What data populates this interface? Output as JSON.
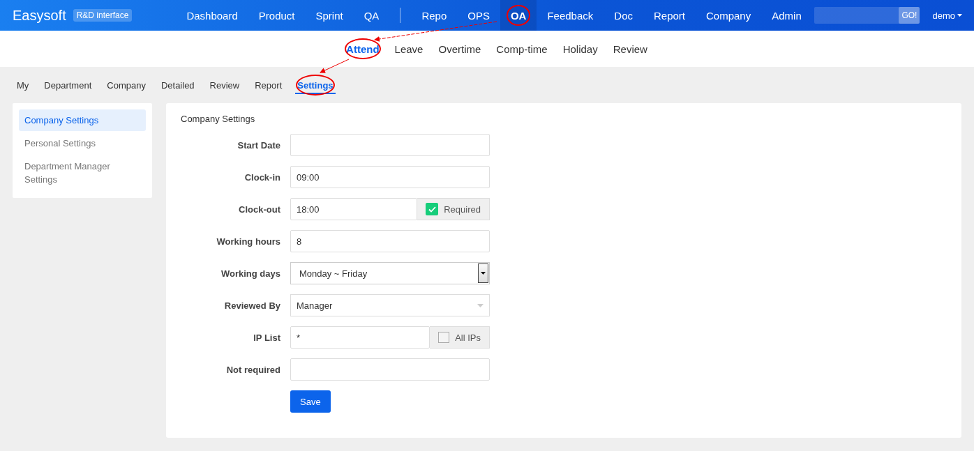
{
  "brand": {
    "name": "Easysoft",
    "badge": "R&D interface"
  },
  "main_nav": [
    {
      "label": "Dashboard",
      "selected": false,
      "annotated": false,
      "divider_after": false
    },
    {
      "label": "Product",
      "selected": false,
      "annotated": false,
      "divider_after": false
    },
    {
      "label": "Sprint",
      "selected": false,
      "annotated": false,
      "divider_after": false
    },
    {
      "label": "QA",
      "selected": false,
      "annotated": false,
      "divider_after": true
    },
    {
      "label": "Repo",
      "selected": false,
      "annotated": false,
      "divider_after": false
    },
    {
      "label": "OPS",
      "selected": false,
      "annotated": false,
      "divider_after": false
    },
    {
      "label": "OA",
      "selected": true,
      "annotated": true,
      "divider_after": false
    },
    {
      "label": "Feedback",
      "selected": false,
      "annotated": false,
      "divider_after": false
    },
    {
      "label": "Doc",
      "selected": false,
      "annotated": false,
      "divider_after": false
    },
    {
      "label": "Report",
      "selected": false,
      "annotated": false,
      "divider_after": false
    },
    {
      "label": "Company",
      "selected": false,
      "annotated": false,
      "divider_after": false
    },
    {
      "label": "Admin",
      "selected": false,
      "annotated": false,
      "divider_after": false
    }
  ],
  "search": {
    "button": "GO!"
  },
  "user_menu": {
    "label": "demo"
  },
  "sub_nav": [
    {
      "label": "Attend",
      "selected": true,
      "annotated": true
    },
    {
      "label": "Leave",
      "selected": false,
      "annotated": false
    },
    {
      "label": "Overtime",
      "selected": false,
      "annotated": false
    },
    {
      "label": "Comp-time",
      "selected": false,
      "annotated": false
    },
    {
      "label": "Holiday",
      "selected": false,
      "annotated": false
    },
    {
      "label": "Review",
      "selected": false,
      "annotated": false
    }
  ],
  "tabs": [
    {
      "label": "My",
      "selected": false,
      "annotated": false
    },
    {
      "label": "Department",
      "selected": false,
      "annotated": false
    },
    {
      "label": "Company",
      "selected": false,
      "annotated": false
    },
    {
      "label": "Detailed",
      "selected": false,
      "annotated": false
    },
    {
      "label": "Review",
      "selected": false,
      "annotated": false
    },
    {
      "label": "Report",
      "selected": false,
      "annotated": false
    },
    {
      "label": "Settings",
      "selected": true,
      "annotated": true
    }
  ],
  "sidebar": {
    "items": [
      {
        "label": "Company Settings",
        "selected": true
      },
      {
        "label": "Personal Settings",
        "selected": false
      },
      {
        "label": "Department Manager Settings",
        "selected": false
      }
    ]
  },
  "panel": {
    "title": "Company Settings",
    "fields": [
      {
        "label": "Start Date",
        "kind": "text"
      },
      {
        "label": "Clock-in",
        "kind": "text",
        "value": "09:00"
      },
      {
        "label": "Clock-out",
        "kind": "text",
        "value": "18:00",
        "addon": {
          "label": "Required",
          "checked": true
        }
      },
      {
        "label": "Working hours",
        "kind": "text",
        "value": "8"
      },
      {
        "label": "Working days",
        "kind": "select",
        "value": "Monday ~ Friday"
      },
      {
        "label": "Reviewed By",
        "kind": "chosen",
        "value": "Manager"
      },
      {
        "label": "IP List",
        "kind": "text",
        "value": "*",
        "addon": {
          "label": "All IPs",
          "checked": false
        }
      },
      {
        "label": "Not required",
        "kind": "text"
      }
    ],
    "save_button": "Save"
  }
}
